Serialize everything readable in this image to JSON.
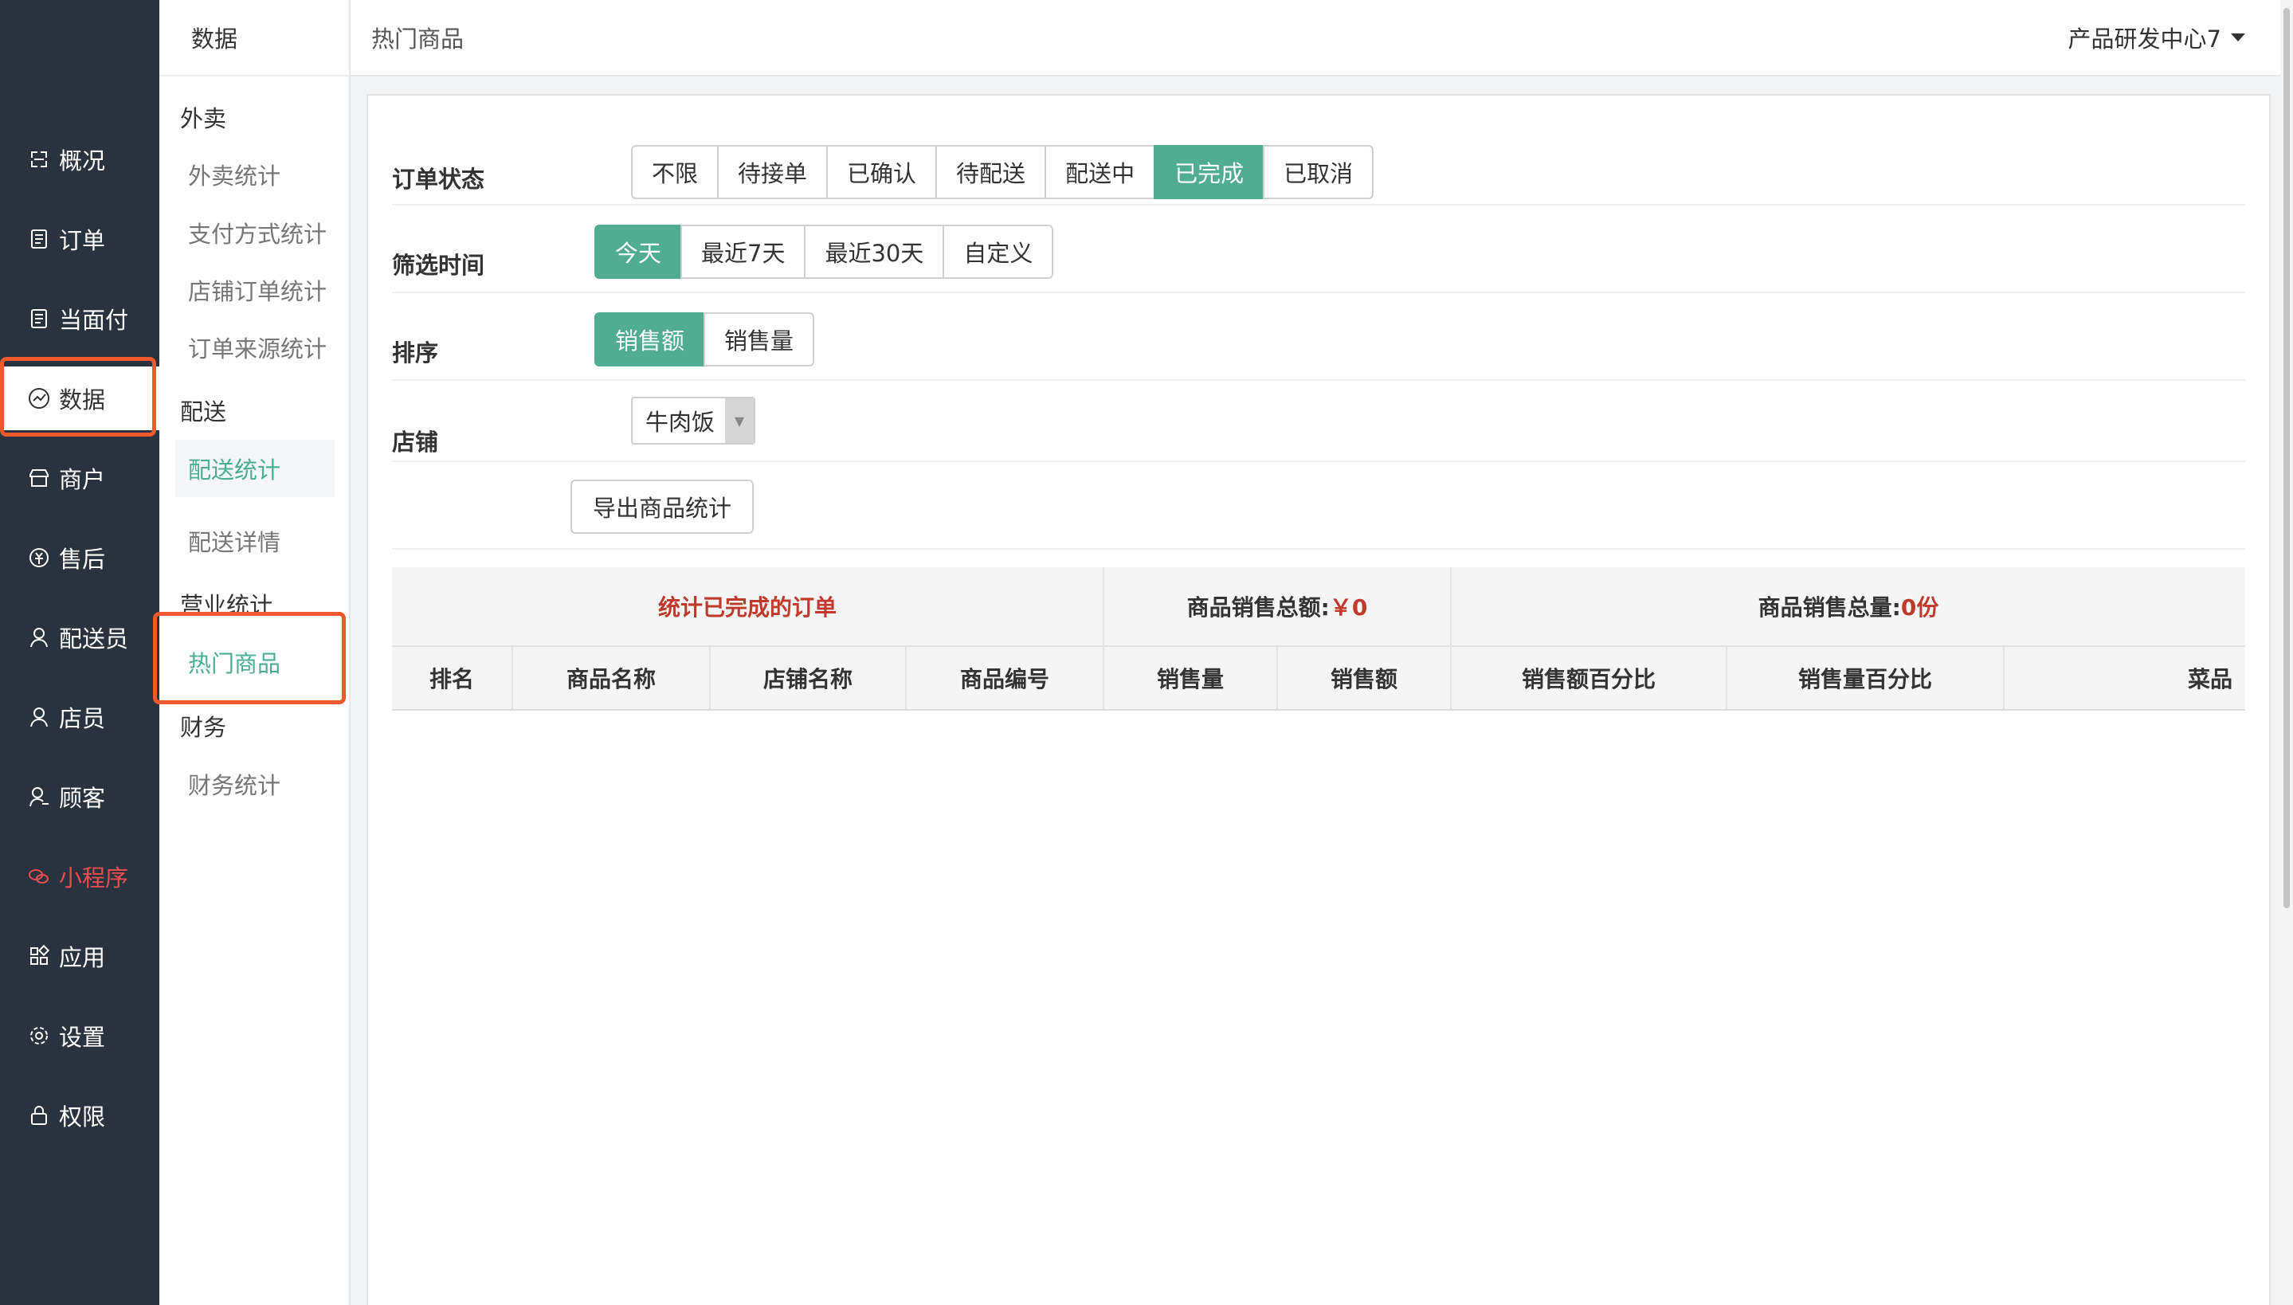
{
  "nav": {
    "items": [
      {
        "label": "概况",
        "icon": "overview-icon"
      },
      {
        "label": "订单",
        "icon": "order-icon"
      },
      {
        "label": "当面付",
        "icon": "face-pay-icon"
      },
      {
        "label": "数据",
        "icon": "data-chart-icon"
      },
      {
        "label": "商户",
        "icon": "shop-icon"
      },
      {
        "label": "售后",
        "icon": "after-sale-icon"
      },
      {
        "label": "配送员",
        "icon": "courier-icon"
      },
      {
        "label": "店员",
        "icon": "clerk-icon"
      },
      {
        "label": "顾客",
        "icon": "customer-icon"
      },
      {
        "label": "小程序",
        "icon": "mini-program-icon"
      },
      {
        "label": "应用",
        "icon": "apps-icon"
      },
      {
        "label": "设置",
        "icon": "settings-gear-icon"
      },
      {
        "label": "权限",
        "icon": "lock-icon"
      }
    ]
  },
  "subnav": {
    "title": "数据",
    "groups": [
      {
        "label": "外卖",
        "items": [
          "外卖统计",
          "支付方式统计",
          "店铺订单统计",
          "订单来源统计"
        ]
      },
      {
        "label": "配送",
        "items": [
          "配送统计",
          "配送详情"
        ]
      },
      {
        "label": "营业统计",
        "items": [
          "热门商品"
        ]
      },
      {
        "label": "财务",
        "items": [
          "财务统计"
        ]
      }
    ]
  },
  "header": {
    "breadcrumb": "热门商品",
    "org_name": "产品研发中心7"
  },
  "filters": {
    "order_status": {
      "label": "订单状态",
      "options": [
        "不限",
        "待接单",
        "已确认",
        "待配送",
        "配送中",
        "已完成",
        "已取消"
      ],
      "selected": "已完成"
    },
    "time": {
      "label": "筛选时间",
      "options": [
        "今天",
        "最近7天",
        "最近30天",
        "自定义"
      ],
      "selected": "今天"
    },
    "sort": {
      "label": "排序",
      "options": [
        "销售额",
        "销售量"
      ],
      "selected": "销售额"
    },
    "store": {
      "label": "店铺",
      "value": "牛肉饭"
    },
    "export_label": "导出商品统计"
  },
  "summary": {
    "completed_label": "统计已完成的订单",
    "total_sales_label": "商品销售总额:",
    "total_sales_value": "￥0",
    "total_qty_label": "商品销售总量:",
    "total_qty_value": "0份"
  },
  "table": {
    "columns": [
      "排名",
      "商品名称",
      "店铺名称",
      "商品编号",
      "销售量",
      "销售额",
      "销售额百分比",
      "销售量百分比",
      "菜品"
    ]
  },
  "colors": {
    "accent_green": "#50ad92",
    "nav_bg": "#28333f",
    "highlight_orange": "#ee5a2c",
    "value_red": "#c0392b"
  }
}
